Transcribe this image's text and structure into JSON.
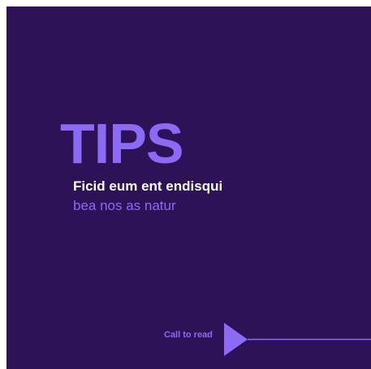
{
  "card": {
    "background": "#2d1258",
    "accent": "#8c6af6",
    "text_color": "#ffffff"
  },
  "heading": "TIPS",
  "subtitle_line1": "Ficid eum ent endisqui",
  "subtitle_line2": "bea nos as natur",
  "cta": {
    "label": "Call to read",
    "icon": "arrow-right-icon"
  }
}
